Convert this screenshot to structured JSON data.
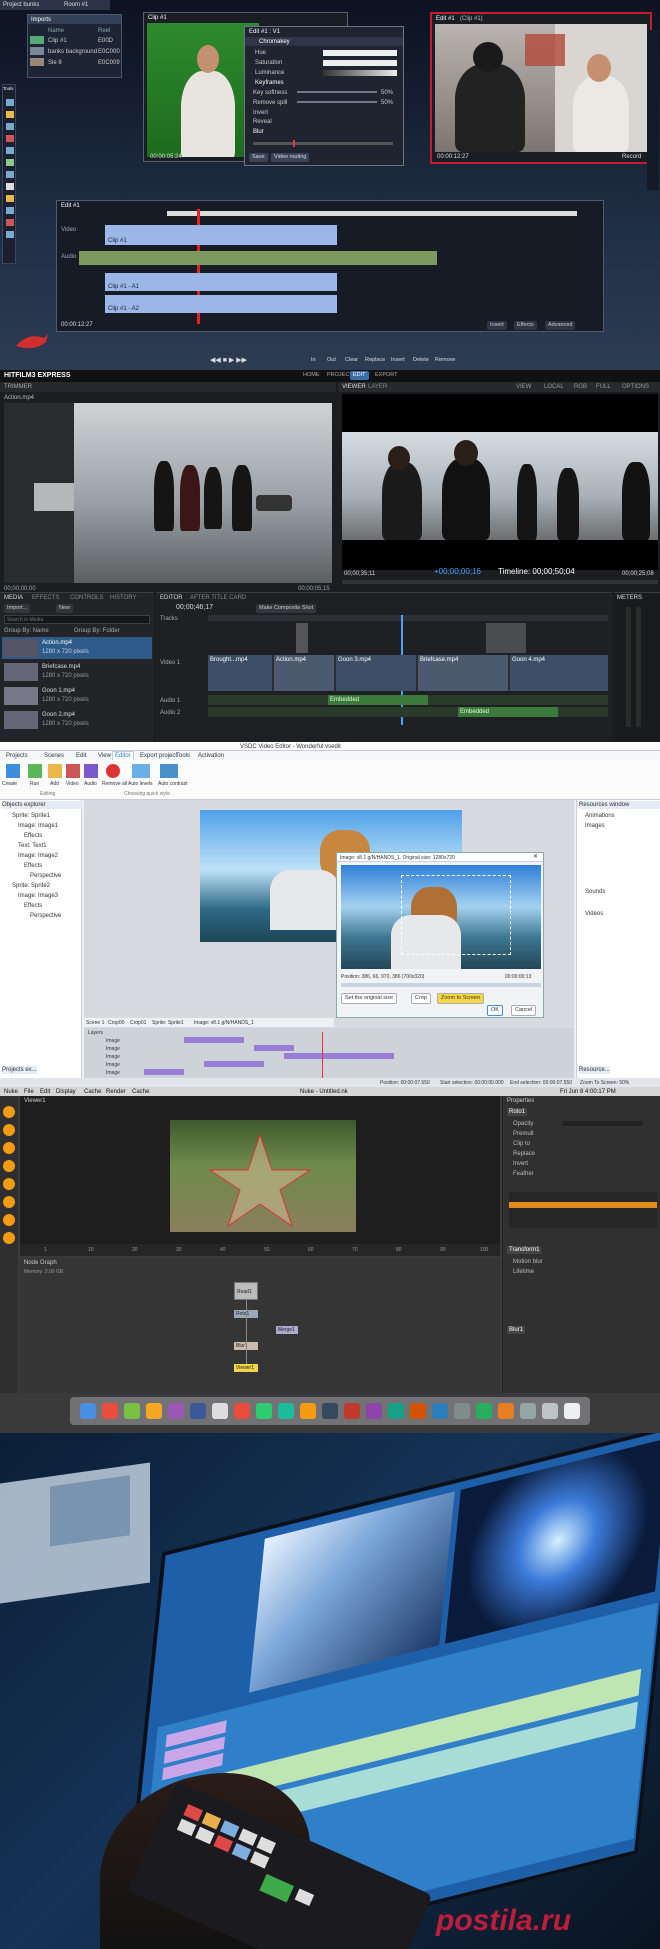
{
  "panel1": {
    "project_title": "Project bunks",
    "room_tab": "Room #1",
    "imports_header": "Imports",
    "imports_columns": [
      "Name",
      "Reel"
    ],
    "imports_rows": [
      {
        "name": "Clip #1",
        "reel": "E00D"
      },
      {
        "name": "banks background",
        "reel": "E0C000"
      },
      {
        "name": "Sle 8",
        "reel": "E0C009"
      }
    ],
    "tools_label": "Tools",
    "clip_window_title": "Clip #1",
    "clip_timecode": "00:00:05:24",
    "effects_window_title": "Edit #1 : V1",
    "chromakey_label": "Chromakey",
    "chromakey_params": [
      "Hue",
      "Saturation",
      "Luminance"
    ],
    "keyframe_label": "Keyframes",
    "key_params": [
      {
        "name": "Key softness",
        "value": "50%"
      },
      {
        "name": "Remove spill",
        "value": "50%"
      },
      {
        "name": "Invert",
        "value": ""
      },
      {
        "name": "Reveal",
        "value": ""
      }
    ],
    "blur_label": "Blur",
    "save_button": "Save",
    "video_routing_button": "Video routing",
    "program_window_title": "Edit #1",
    "program_window_subtitle": "(Clip #1)",
    "program_timecode": "00:00:12:27",
    "program_record_label": "Record",
    "timeline_title": "Edit #1",
    "timeline_timecode": "00:00:12:27",
    "track_labels": [
      "Video",
      "Clip #1",
      "Audio",
      "Clip #1 - A1",
      "Clip #1 - A2"
    ],
    "timeline_buttons": [
      "Insert",
      "Effects",
      "Advanced"
    ],
    "transport_buttons": [
      "In",
      "Out",
      "Clear",
      "Replace",
      "Insert",
      "Delete",
      "Remove"
    ]
  },
  "panel2": {
    "app_name": "HITFILM3 EXPRESS",
    "top_tabs": [
      "HOME",
      "PROJECT",
      "EDIT",
      "EXPORT"
    ],
    "active_tab": "EDIT",
    "left_tabs": [
      "TRIMMER"
    ],
    "viewer_tabs": [
      "VIEWER",
      "LAYER"
    ],
    "viewer_options": [
      "VIEW",
      "LOCAL",
      "RGB",
      "FULL",
      "OPTIONS"
    ],
    "trimmer_file": "Action.mp4",
    "trimmer_timecode_start": "00;00;00;00",
    "trimmer_timecode_end": "00;00;05;15",
    "viewer_time_left": "00;00;35;11",
    "viewer_time_center": "+00;00;00;16",
    "viewer_time_label": "Timeline: 00;00;50;04",
    "viewer_time_right": "00;00;25;08",
    "media_tabs": [
      "MEDIA",
      "EFFECTS",
      "CONTROLS",
      "HISTORY"
    ],
    "import_button": "Import...",
    "new_button": "New",
    "search_placeholder": "Search in Media",
    "group_by": "Group By: Name",
    "group_by_folder": "Group By: Folder",
    "media_items": [
      {
        "name": "Action.mp4",
        "info": "1280 x 720 pixels"
      },
      {
        "name": "Briefcase.mp4",
        "info": "1280 x 720 pixels"
      },
      {
        "name": "Goon 1.mp4",
        "info": "1280 x 720 pixels"
      },
      {
        "name": "Goon 2.mp4",
        "info": "1280 x 720 pixels"
      }
    ],
    "editor_tabs": [
      "EDITOR",
      "AFTER TITLE CARD"
    ],
    "editor_timecode": "00;00;46;17",
    "make_composite_button": "Make Composite Shot",
    "track_names": [
      "Tracks",
      "Video 1",
      "Audio 1",
      "Audio 2"
    ],
    "meters_label": "METERS",
    "clip_labels": [
      "Brought...mp4",
      "Action.mp4",
      "Goon 3.mp4",
      "Briefcase.mp4",
      "Goon 4.mp4"
    ],
    "audio_clip_labels": [
      "Embedded",
      "Embedded"
    ]
  },
  "panel3": {
    "window_title": "VSDC Video Editor - Wonderful.vsedit",
    "menu_tabs": [
      "Projects",
      "Scenes",
      "Edit",
      "View",
      "Editor",
      "Export project",
      "Tools",
      "Activation"
    ],
    "ribbon_buttons": [
      "Create",
      "Run",
      "Add",
      "Video",
      "Audio",
      "Remove all",
      "Auto levels",
      "Auto contrast"
    ],
    "ribbon_groups": [
      "Editing",
      "Choosing quick style"
    ],
    "objects_explorer_title": "Objects explorer",
    "tree_items": [
      "Sprite: Sprite1",
      "Image: Image1",
      "Effects",
      "Text: Text1",
      "Image: Image2",
      "Effects",
      "Perspective",
      "Sprite: Sprite2",
      "Image: Image3",
      "Effects",
      "Perspective"
    ],
    "dialog_title": "Image: v8.1 g/N/HANDS_1. Original size: 1280x720",
    "dialog_position_label": "Position: 386, 66, 970, 386 (700x320)",
    "dialog_time": "00:00:00:13",
    "dialog_dropdown": "Set the original size",
    "dialog_buttons": [
      "Crop",
      "Zoom to Screen",
      "OK",
      "Cancel"
    ],
    "scene_tabs": [
      "Scene 1",
      "Crop00",
      "Crop01",
      "Sprite: Sprite1",
      "Image: v8.1 g/N/HANDS_1"
    ],
    "layers_label": "Layers",
    "track_names": [
      "Image",
      "Image",
      "Image",
      "Image",
      "Image"
    ],
    "resources_title": "Resources window",
    "resources_items": [
      "Animations",
      "Images",
      "Sounds",
      "Videos"
    ],
    "status_bar": [
      "Position: 00:00:07.550",
      "Start selection: 00:00:00.000",
      "End selection: 00:00:07.550",
      "Zoom To Screen: 50%"
    ],
    "objects_explorer_tab": "Projects ex...",
    "resources_tab": "Resource..."
  },
  "panel4": {
    "app_title": "Nuke",
    "window_title": "Nuke - Untitled.nk",
    "menu_items": [
      "Nuke",
      "File",
      "Edit",
      "Display",
      "Cache",
      "Render",
      "Cache"
    ],
    "viewer_label": "Viewer1",
    "node_graph_label": "Node Graph",
    "properties_label": "Properties",
    "node_labels": [
      "Read1",
      "Roto1",
      "Merge1",
      "Blur1",
      "Viewer1"
    ],
    "prop_sections": [
      "Roto1",
      "Transform1",
      "Blur1"
    ],
    "prop_rows": [
      "Opacity",
      "Premult",
      "Clip to",
      "Replace",
      "Invert",
      "Feather",
      "Motion blur",
      "Lifetime"
    ],
    "timeline_frames": [
      "1",
      "10",
      "20",
      "30",
      "40",
      "50",
      "60",
      "70",
      "80",
      "90",
      "100"
    ],
    "memory_label": "Memory: 2.00 GB",
    "clock": "Fri Jun 8 4:00:17 PM"
  },
  "panel5": {
    "scene_description": ""
  },
  "watermark": "postila.ru",
  "colors": {
    "hitfilm_accent": "#ff8a00",
    "vsdc_accent": "#1e78d2",
    "nuke_accent": "#f39c12",
    "lightworks_clip": "#9bb7e8",
    "lightworks_program_border": "#c21e2d",
    "watermark_color": "#d21e3c"
  }
}
